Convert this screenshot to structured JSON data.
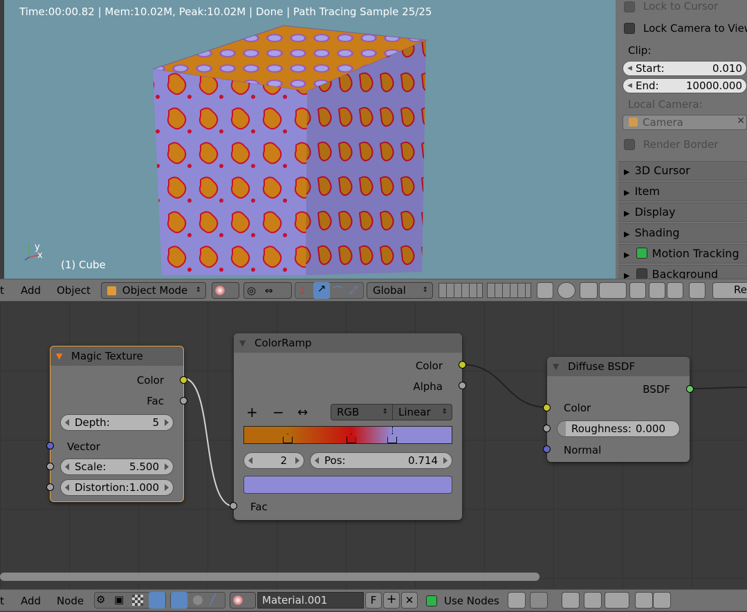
{
  "viewport": {
    "status": "Time:00:00.82 | Mem:10.02M, Peak:10.02M | Done | Path Tracing Sample 25/25",
    "object_label": "(1) Cube",
    "axis_y": "y",
    "axis_x": "x"
  },
  "properties": {
    "lock_to_cursor": "Lock to Cursor",
    "lock_camera_to_view": "Lock Camera to View",
    "clip_label": "Clip:",
    "clip_start_label": "Start:",
    "clip_start_value": "0.010",
    "clip_end_label": "End:",
    "clip_end_value": "10000.000",
    "local_camera_label": "Local Camera:",
    "camera_value": "Camera",
    "render_border": "Render Border",
    "panels": [
      "3D Cursor",
      "Item",
      "Display",
      "Shading",
      "Motion Tracking",
      "Background Images"
    ]
  },
  "view3d_header": {
    "menu_view": "t",
    "menu_add": "Add",
    "menu_object": "Object",
    "mode": "Object Mode",
    "orientation": "Global",
    "render_label": "Re"
  },
  "nodes": {
    "magic_texture": {
      "title": "Magic Texture",
      "out_color": "Color",
      "out_fac": "Fac",
      "depth_label": "Depth:",
      "depth_value": "5",
      "in_vector": "Vector",
      "scale_label": "Scale:",
      "scale_value": "5.500",
      "distortion_label": "Distortion:",
      "distortion_value": "1.000"
    },
    "color_ramp": {
      "title": "ColorRamp",
      "out_color": "Color",
      "out_alpha": "Alpha",
      "add_symbol": "+",
      "remove_symbol": "−",
      "flip_symbol": "↔",
      "color_mode": "RGB",
      "interpolation": "Linear",
      "active_index": "2",
      "pos_label": "Pos:",
      "pos_value": "0.714",
      "in_fac": "Fac",
      "active_color": "#8f8ad6",
      "stops": [
        {
          "pos": 0.21,
          "color": "#b5690c"
        },
        {
          "pos": 0.515,
          "color": "#c8100f"
        },
        {
          "pos": 0.714,
          "color": "#8f8ad6"
        }
      ]
    },
    "diffuse_bsdf": {
      "title": "Diffuse BSDF",
      "out_bsdf": "BSDF",
      "in_color": "Color",
      "roughness_label": "Roughness:",
      "roughness_value": "0.000",
      "in_normal": "Normal"
    }
  },
  "node_header": {
    "menu_view": "t",
    "menu_add": "Add",
    "menu_node": "Node",
    "material_name": "Material.001",
    "fake_user": "F",
    "use_nodes": "Use Nodes"
  },
  "colors": {
    "viewport_bg": "#6f97a6",
    "texture_orange": "#c97e17",
    "texture_lilac": "#8f8ad6",
    "socket_color": "#c7c729",
    "socket_shader": "#63c763",
    "socket_vector": "#6363c7",
    "node_selected_border": "#f0a030"
  }
}
